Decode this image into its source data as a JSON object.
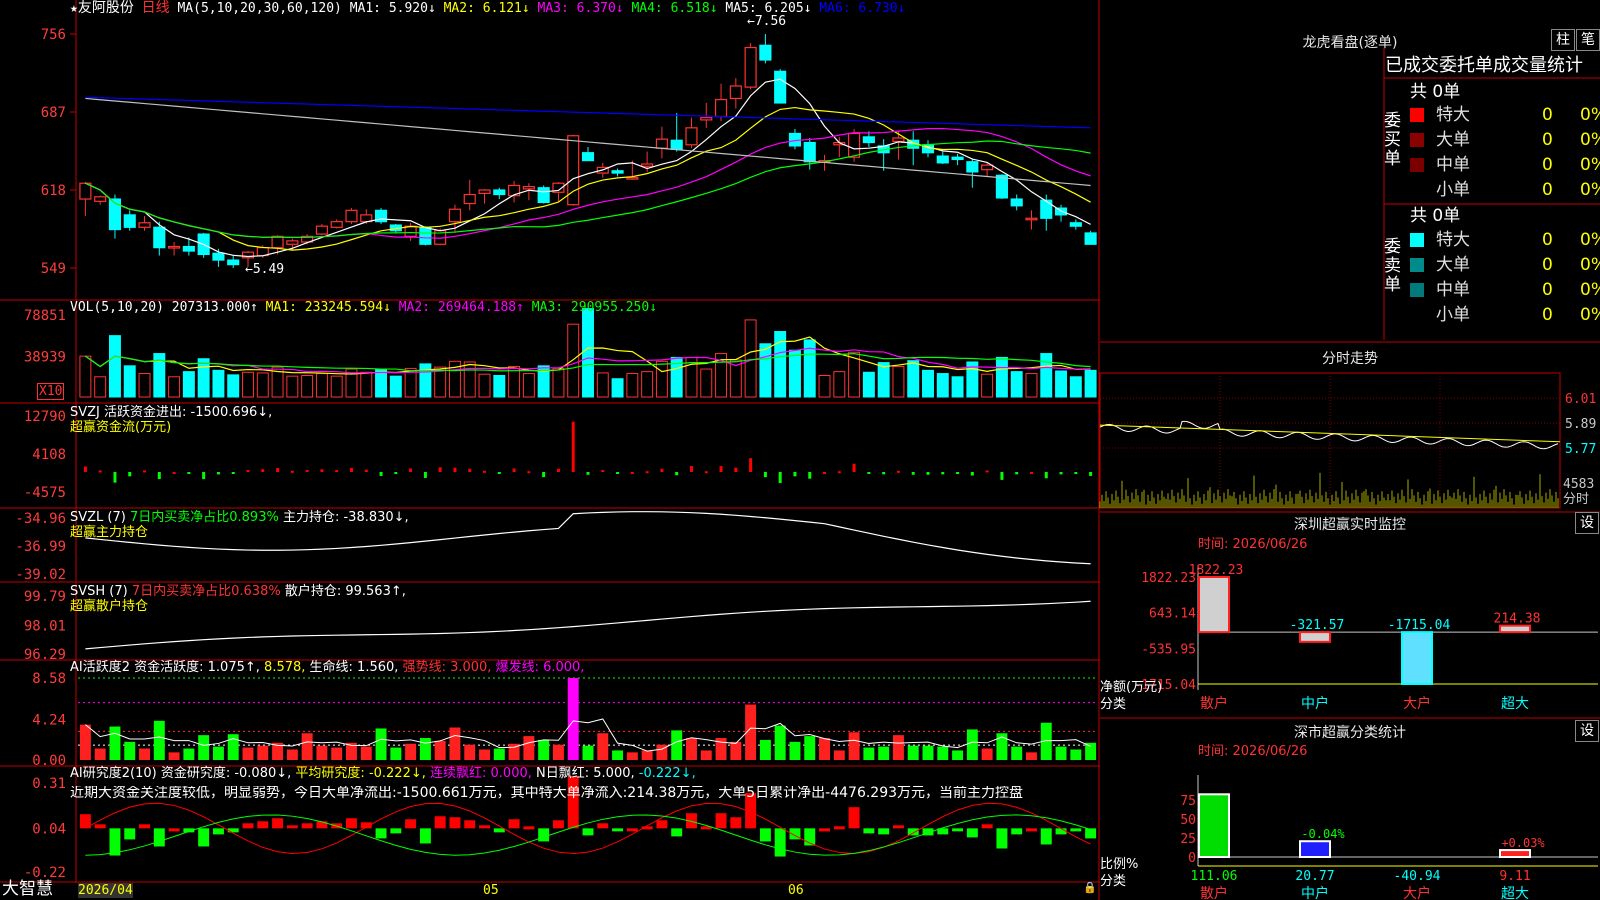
{
  "app": {
    "logo": "大智慧"
  },
  "kline": {
    "header": {
      "star": "★",
      "stock": "友阿股份",
      "period": "日线",
      "ma_params": "MA(5,10,20,30,60,120)",
      "ma1": "MA1: 5.920↓",
      "ma2": "MA2: 6.121↓",
      "ma3": "MA3: 6.370↓",
      "ma4": "MA4: 6.518↓",
      "ma5": "MA5: 6.205↓",
      "ma6": "MA6: 6.730↓"
    },
    "ticks": [
      "756",
      "687",
      "618",
      "549"
    ],
    "tick_values": [
      7.56,
      6.87,
      6.18,
      5.49
    ],
    "high_label": "←7.56",
    "low_label": "←5.49",
    "candles": [
      [
        6.1,
        6.24,
        5.95,
        6.25
      ],
      [
        6.08,
        6.12,
        6.05,
        6.13
      ],
      [
        6.1,
        5.83,
        5.75,
        6.14
      ],
      [
        5.96,
        5.85,
        5.82,
        6.0
      ],
      [
        5.85,
        5.89,
        5.82,
        5.95
      ],
      [
        5.85,
        5.67,
        5.6,
        5.9
      ],
      [
        5.68,
        5.68,
        5.6,
        5.72
      ],
      [
        5.68,
        5.64,
        5.6,
        5.76
      ],
      [
        5.79,
        5.61,
        5.58,
        5.8
      ],
      [
        5.62,
        5.56,
        5.5,
        5.66
      ],
      [
        5.56,
        5.52,
        5.49,
        5.6
      ],
      [
        5.58,
        5.63,
        5.5,
        5.64
      ],
      [
        5.6,
        5.67,
        5.58,
        5.69
      ],
      [
        5.67,
        5.77,
        5.61,
        5.78
      ],
      [
        5.7,
        5.73,
        5.65,
        5.75
      ],
      [
        5.72,
        5.77,
        5.7,
        5.79
      ],
      [
        5.79,
        5.86,
        5.78,
        5.88
      ],
      [
        5.85,
        5.9,
        5.84,
        5.92
      ],
      [
        5.9,
        6.0,
        5.88,
        6.02
      ],
      [
        5.9,
        5.96,
        5.88,
        6.01
      ],
      [
        6.0,
        5.9,
        5.88,
        6.02
      ],
      [
        5.87,
        5.82,
        5.8,
        5.88
      ],
      [
        5.77,
        5.86,
        5.73,
        5.89
      ],
      [
        5.85,
        5.7,
        5.69,
        5.86
      ],
      [
        5.7,
        5.82,
        5.69,
        5.84
      ],
      [
        5.9,
        6.01,
        5.8,
        6.05
      ],
      [
        6.06,
        6.14,
        6.0,
        6.27
      ],
      [
        6.15,
        6.18,
        6.06,
        6.19
      ],
      [
        6.18,
        6.14,
        6.1,
        6.2
      ],
      [
        6.13,
        6.22,
        6.07,
        6.26
      ],
      [
        6.19,
        6.21,
        6.09,
        6.24
      ],
      [
        6.2,
        6.07,
        6.06,
        6.22
      ],
      [
        6.16,
        6.24,
        6.08,
        6.25
      ],
      [
        6.05,
        6.66,
        6.04,
        6.67
      ],
      [
        6.51,
        6.44,
        6.44,
        6.56
      ],
      [
        6.33,
        6.38,
        6.29,
        6.42
      ],
      [
        6.35,
        6.33,
        6.3,
        6.37
      ],
      [
        6.29,
        6.29,
        6.27,
        6.44
      ],
      [
        6.39,
        6.41,
        6.34,
        6.52
      ],
      [
        6.55,
        6.63,
        6.46,
        6.74
      ],
      [
        6.62,
        6.54,
        6.52,
        6.86
      ],
      [
        6.58,
        6.73,
        6.55,
        6.82
      ],
      [
        6.8,
        6.82,
        6.73,
        6.95
      ],
      [
        6.83,
        6.98,
        6.79,
        7.12
      ],
      [
        6.99,
        7.1,
        6.9,
        7.17
      ],
      [
        7.09,
        7.44,
        7.07,
        7.48
      ],
      [
        7.46,
        7.33,
        7.3,
        7.56
      ],
      [
        7.23,
        6.95,
        6.95,
        7.25
      ],
      [
        6.68,
        6.57,
        6.54,
        6.72
      ],
      [
        6.6,
        6.43,
        6.36,
        6.64
      ],
      [
        6.44,
        6.44,
        6.35,
        6.49
      ],
      [
        6.58,
        6.6,
        6.47,
        6.65
      ],
      [
        6.47,
        6.68,
        6.43,
        6.72
      ],
      [
        6.65,
        6.6,
        6.56,
        6.7
      ],
      [
        6.57,
        6.51,
        6.35,
        6.63
      ],
      [
        6.61,
        6.64,
        6.45,
        6.7
      ],
      [
        6.62,
        6.55,
        6.4,
        6.7
      ],
      [
        6.58,
        6.51,
        6.47,
        6.62
      ],
      [
        6.48,
        6.42,
        6.41,
        6.52
      ],
      [
        6.47,
        6.45,
        6.4,
        6.5
      ],
      [
        6.43,
        6.34,
        6.2,
        6.46
      ],
      [
        6.36,
        6.4,
        6.3,
        6.42
      ],
      [
        6.31,
        6.11,
        6.1,
        6.32
      ],
      [
        6.1,
        6.04,
        6.0,
        6.14
      ],
      [
        5.93,
        5.93,
        5.83,
        6.0
      ],
      [
        6.09,
        5.93,
        5.82,
        6.14
      ],
      [
        6.02,
        5.96,
        5.9,
        6.05
      ],
      [
        5.89,
        5.86,
        5.83,
        5.92
      ],
      [
        5.8,
        5.7,
        5.7,
        5.82
      ]
    ]
  },
  "vol": {
    "label": "VOL(5,10,20)",
    "value": "207313.000↑",
    "ma1": "MA1: 233245.594↓",
    "ma2": "MA2: 269464.188↑",
    "ma3": "MA3: 290955.250↓",
    "ticks": [
      "78851",
      "38939"
    ],
    "tick_values": [
      78851,
      38939
    ],
    "unit": "X10"
  },
  "svzj": {
    "label": "SVZJ  活跃资金进出: -1500.696↓,",
    "sub": "超赢资金流(万元)",
    "ticks": [
      "12790",
      "4108",
      "-4575"
    ],
    "tick_values": [
      12790,
      4108,
      -4575
    ]
  },
  "svzl": {
    "label": "SVZL (7) ",
    "label2": "7日内买卖净占比0.893%",
    "label3": "主力持仓: -38.830↓,",
    "sub": "超赢主力持仓",
    "ticks": [
      "-34.96",
      "-36.99",
      "-39.02"
    ],
    "tick_values": [
      -34.96,
      -36.99,
      -39.02
    ]
  },
  "svsh": {
    "label": "SVSH (7) ",
    "label2": "7日内买卖净占比0.638%",
    "label3": "散户持仓: 99.563↑,",
    "sub": "超赢散户持仓",
    "ticks": [
      "99.79",
      "98.01",
      "96.29"
    ],
    "tick_values": [
      99.79,
      98.01,
      96.29
    ]
  },
  "ai2": {
    "label": "AI活跃度2",
    "l1": "资金活跃度: 1.075↑,",
    "l2": "8.578,",
    "l3": "生命线: 1.560,",
    "l4": "强势线: 3.000,",
    "l5": "爆发线: 6.000,",
    "ticks": [
      "8.58",
      "4.24",
      "0.00"
    ],
    "tick_values": [
      8.58,
      4.24,
      0.0
    ]
  },
  "ai_research": {
    "label": "AI研究度2(10)",
    "l1": "资金研究度: -0.080↓,",
    "l2": "平均研究度: -0.222↓,",
    "l3": "连续飘红: 0.000,",
    "l4": "N日飘红: 5.000,",
    "l5": "-0.222↓,",
    "comment": "近期大资金关注度较低，明显弱势，今日大单净流出:-1500.661万元，其中特大单净流入:214.38万元，大单5日累计净出-4476.293万元，当前主力控盘",
    "ticks": [
      "0.31",
      "0.04",
      "-0.22"
    ],
    "tick_values": [
      0.31,
      0.04,
      -0.22
    ]
  },
  "xaxis": {
    "labels": [
      "2026/04",
      "05",
      "06"
    ]
  },
  "lhb": {
    "title": "龙虎看盘(逐单)",
    "btn_bar": "柱",
    "btn_bi": "笔",
    "tab": "已成交委托单成交量统计",
    "buy": {
      "side": "委买单",
      "total": "共 0单",
      "rows": [
        {
          "name": "特大",
          "n": "0",
          "p": "0%",
          "color": "#ff0000"
        },
        {
          "name": "大单",
          "n": "0",
          "p": "0%",
          "color": "#8b0000"
        },
        {
          "name": "中单",
          "n": "0",
          "p": "0%",
          "color": "#7a0000"
        },
        {
          "name": "小单",
          "n": "0",
          "p": "0%",
          "color": ""
        }
      ]
    },
    "sell": {
      "side": "委卖单",
      "total": "共 0单",
      "rows": [
        {
          "name": "特大",
          "n": "0",
          "p": "0%",
          "color": "#00ffff"
        },
        {
          "name": "大单",
          "n": "0",
          "p": "0%",
          "color": "#008b8b"
        },
        {
          "name": "中单",
          "n": "0",
          "p": "0%",
          "color": "#007a7a"
        },
        {
          "name": "小单",
          "n": "0",
          "p": "0%",
          "color": ""
        }
      ]
    }
  },
  "fenshi": {
    "title": "分时走势",
    "ticks": [
      "6.01",
      "5.89",
      "5.77"
    ],
    "tick_values": [
      6.01,
      5.89,
      5.77
    ],
    "vol_tick": "4583",
    "vol_unit": "分时"
  },
  "monitor": {
    "title": "深圳超赢实时监控",
    "btn": "设",
    "time": "时间: 2026/06/26",
    "ticks": [
      "1822.23",
      "643.14",
      "-535.95",
      "-1715.04"
    ],
    "tick_values": [
      1822.23,
      643.14,
      -535.95,
      -1715.04
    ],
    "ylabel": "净额(万元)",
    "xlabel": "分类",
    "chart_data": {
      "type": "bar",
      "categories": [
        "散户",
        "中户",
        "大户",
        "超大"
      ],
      "values": [
        1822.23,
        -321.57,
        -1715.04,
        214.38
      ],
      "value_labels": [
        "1822.23",
        "-321.57",
        "-1715.04",
        "214.38"
      ],
      "ylim": [
        -1715.04,
        1822.23
      ]
    }
  },
  "classify": {
    "title": "深市超赢分类统计",
    "btn": "设",
    "time": "时间: 2026/06/26",
    "ticks": [
      "75",
      "50",
      "25",
      "0"
    ],
    "tick_values": [
      75,
      50,
      25,
      0
    ],
    "ylabel": "比例%",
    "xlabel": "分类",
    "chart_data": {
      "type": "bar",
      "categories": [
        "散户",
        "中户",
        "大户",
        "超大"
      ],
      "values": [
        111.06,
        20.77,
        -40.94,
        9.11
      ],
      "value_labels": [
        "111.06",
        "20.77",
        "-40.94",
        "9.11"
      ],
      "pct_labels": [
        "",
        "-0.04%",
        "",
        "+0.03%"
      ],
      "ylim": [
        0,
        75
      ]
    }
  },
  "colors": {
    "up": "#ff3232",
    "down": "#00ffff",
    "ma1": "#ffffff",
    "ma2": "#ffff00",
    "ma3": "#ff00ff",
    "ma4": "#00ff00",
    "ma5": "#c0c0c0",
    "ma6": "#0000ff",
    "grid": "#ff0000",
    "label": "#ff3c3c"
  }
}
